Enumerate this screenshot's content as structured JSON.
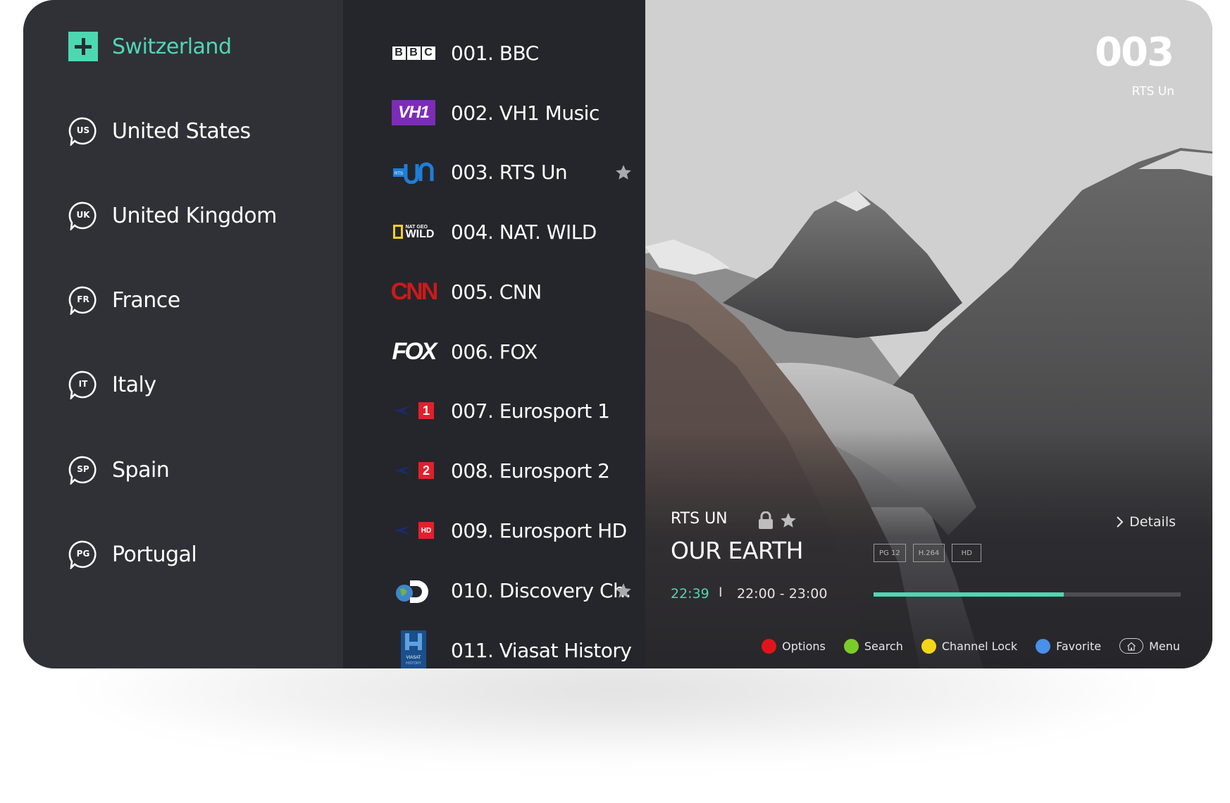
{
  "colors": {
    "accent": "#4ed8b2",
    "options_dot": "#e0151b",
    "search_dot": "#7ccc29",
    "lock_dot": "#f4d619",
    "favorite_dot": "#4a8fe8",
    "cnn_red": "#cc1a1a",
    "vh1_purple": "#7d2cb7",
    "eurosport_red": "#e2202c"
  },
  "countries": [
    {
      "label": "Switzerland",
      "icon": "plus-square-icon",
      "active": true
    },
    {
      "label": "United States",
      "code": "US",
      "icon": "speech-badge-icon"
    },
    {
      "label": "United Kingdom",
      "code": "UK",
      "icon": "speech-badge-icon"
    },
    {
      "label": "France",
      "code": "FR",
      "icon": "speech-badge-icon"
    },
    {
      "label": "Italy",
      "code": "IT",
      "icon": "speech-badge-icon"
    },
    {
      "label": "Spain",
      "code": "SP",
      "icon": "speech-badge-icon"
    },
    {
      "label": "Portugal",
      "code": "PG",
      "icon": "speech-badge-icon"
    }
  ],
  "channels": [
    {
      "name": "001. BBC",
      "logo_text": [
        "B",
        "B",
        "C"
      ],
      "favorite": false
    },
    {
      "name": "002. VH1 Music",
      "logo_text": "VH1",
      "favorite": false
    },
    {
      "name": "003. RTS Un",
      "logo_text": "RTS",
      "favorite": true
    },
    {
      "name": "004. NAT. WILD",
      "logo_text": "WILD",
      "logo_sub": "NAT GEO",
      "favorite": false
    },
    {
      "name": "005. CNN",
      "logo_text": "CNN",
      "favorite": false
    },
    {
      "name": "006. FOX",
      "logo_text": "FOX",
      "favorite": false
    },
    {
      "name": "007. Eurosport 1",
      "logo_text": "1",
      "favorite": false
    },
    {
      "name": "008. Eurosport 2",
      "logo_text": "2",
      "favorite": false
    },
    {
      "name": "009. Eurosport HD",
      "logo_text": "HD",
      "favorite": false
    },
    {
      "name": "010. Discovery Ch.",
      "logo_text": "",
      "favorite": true
    },
    {
      "name": "011. Viasat History",
      "logo_text": "VIASAT",
      "logo_sub": "HISTORY",
      "favorite": false
    }
  ],
  "preview": {
    "channel_number": "003",
    "channel_name": "RTS Un",
    "program_channel": "RTS UN",
    "program_title": "OUR EARTH",
    "details_label": "Details",
    "tags": [
      "PG 12",
      "H.264",
      "HD"
    ],
    "current_time": "22:39",
    "separator": "I",
    "time_range": "22:00 - 23:00",
    "progress_fraction": 0.62
  },
  "legend": [
    {
      "label": "Options",
      "color": "#e0151b"
    },
    {
      "label": "Search",
      "color": "#7ccc29"
    },
    {
      "label": "Channel Lock",
      "color": "#f4d619"
    },
    {
      "label": "Favorite",
      "color": "#4a8fe8"
    },
    {
      "label": "Menu",
      "icon": "home-icon"
    }
  ]
}
